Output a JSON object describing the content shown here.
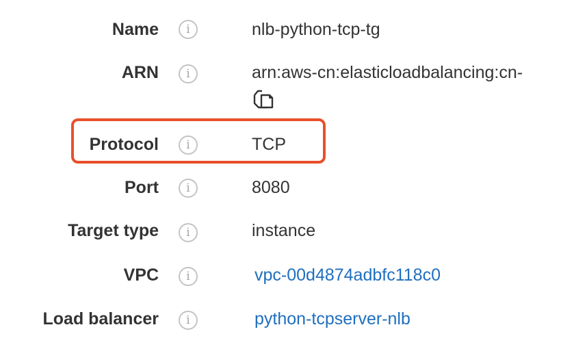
{
  "details": {
    "rows": [
      {
        "label": "Name",
        "value": "nlb-python-tcp-tg"
      },
      {
        "label": "ARN",
        "value": "arn:aws-cn:elasticloadbalancing:cn-"
      },
      {
        "label": "Protocol",
        "value": "TCP"
      },
      {
        "label": "Port",
        "value": "8080"
      },
      {
        "label": "Target type",
        "value": "instance"
      },
      {
        "label": "VPC",
        "value": "vpc-00d4874adbfc118c0"
      },
      {
        "label": "Load balancer",
        "value": "python-tcpserver-nlb"
      }
    ],
    "info_glyph": "i"
  },
  "icons": {
    "info": "info-circle-icon",
    "copy": "copy-icon"
  },
  "colors": {
    "label": "#333333",
    "link": "#1f6fbf",
    "highlight": "#e8502a",
    "info_icon": "#c4c4c4"
  }
}
